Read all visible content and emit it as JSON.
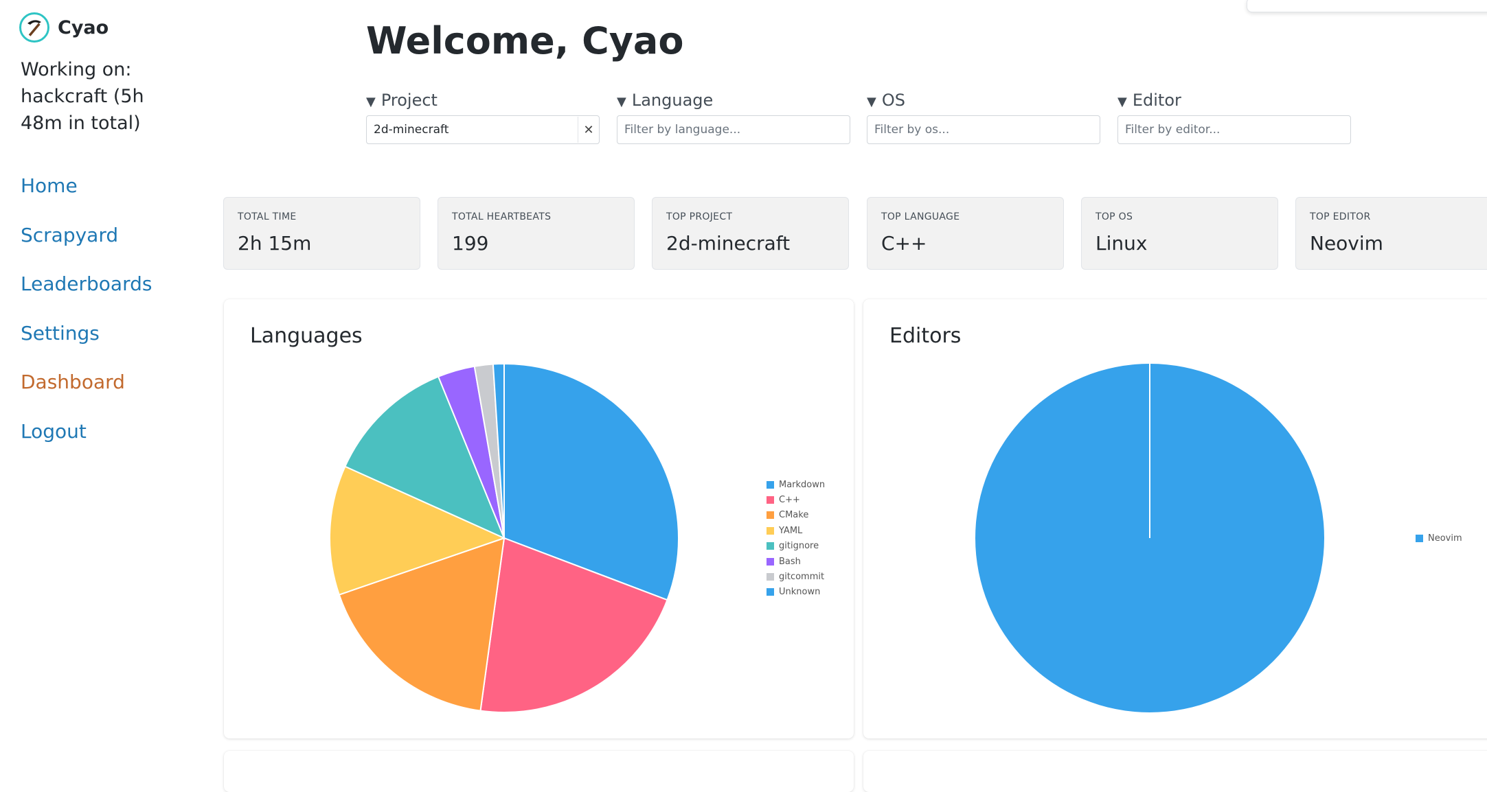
{
  "sidebar": {
    "brand": "Cyao",
    "working_on": "Working on: hackcraft (5h 48m in total)",
    "nav": [
      {
        "label": "Home",
        "active": false
      },
      {
        "label": "Scrapyard",
        "active": false
      },
      {
        "label": "Leaderboards",
        "active": false
      },
      {
        "label": "Settings",
        "active": false
      },
      {
        "label": "Dashboard",
        "active": true
      },
      {
        "label": "Logout",
        "active": false
      }
    ]
  },
  "main": {
    "welcome": "Welcome, Cyao",
    "filters": [
      {
        "label": "Project",
        "value": "2d-minecraft",
        "placeholder": "",
        "clearable": true
      },
      {
        "label": "Language",
        "value": "",
        "placeholder": "Filter by language..."
      },
      {
        "label": "OS",
        "value": "",
        "placeholder": "Filter by os..."
      },
      {
        "label": "Editor",
        "value": "",
        "placeholder": "Filter by editor..."
      }
    ],
    "clear_glyph": "✕",
    "stats": [
      {
        "label": "TOTAL TIME",
        "value": "2h 15m"
      },
      {
        "label": "TOTAL HEARTBEATS",
        "value": "199"
      },
      {
        "label": "TOP PROJECT",
        "value": "2d-minecraft"
      },
      {
        "label": "TOP LANGUAGE",
        "value": "C++"
      },
      {
        "label": "TOP OS",
        "value": "Linux"
      },
      {
        "label": "TOP EDITOR",
        "value": "Neovim"
      }
    ]
  },
  "chart_data": [
    {
      "type": "pie",
      "title": "Languages",
      "categories": [
        "Markdown",
        "C++",
        "CMake",
        "YAML",
        "gitignore",
        "Bash",
        "gitcommit",
        "Unknown"
      ],
      "values": [
        30.5,
        21.2,
        17.4,
        11.9,
        12.0,
        3.4,
        1.7,
        1.0
      ],
      "colors": [
        "#36a2eb",
        "#ff6384",
        "#ff9f40",
        "#ffcd56",
        "#4bc0c0",
        "#9966ff",
        "#c9cbcf",
        "#36a2eb"
      ],
      "legend": "right"
    },
    {
      "type": "pie",
      "title": "Editors",
      "categories": [
        "Neovim"
      ],
      "values": [
        100
      ],
      "colors": [
        "#36a2eb"
      ],
      "legend": "right"
    }
  ]
}
